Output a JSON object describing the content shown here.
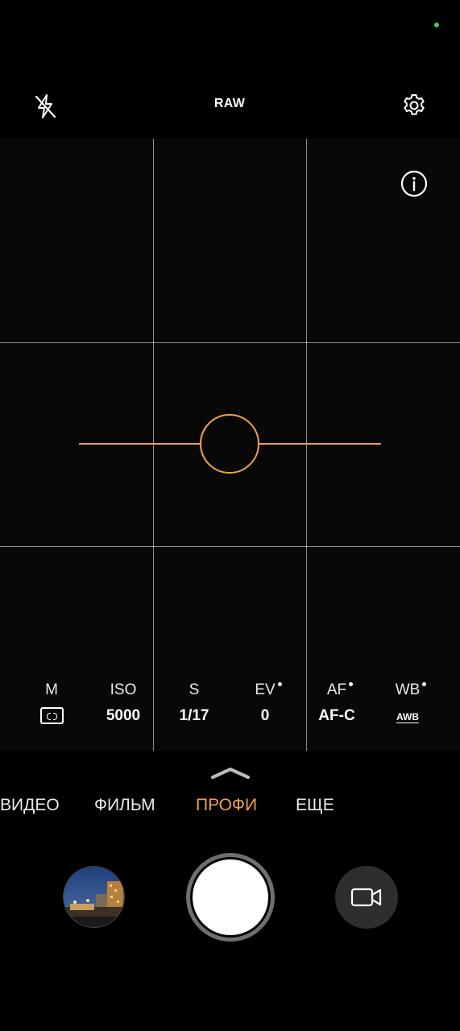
{
  "top_bar": {
    "raw_label": "RAW",
    "flash_icon": "flash-off-icon",
    "settings_icon": "gear-icon"
  },
  "viewfinder": {
    "info_icon": "info-icon",
    "level_color": "#f0a24a"
  },
  "params": [
    {
      "name": "M",
      "value": "",
      "icon": "metering-icon",
      "dot": false
    },
    {
      "name": "ISO",
      "value": "5000",
      "dot": false
    },
    {
      "name": "S",
      "value": "1/17",
      "dot": false
    },
    {
      "name": "EV",
      "value": "0",
      "dot": true
    },
    {
      "name": "AF",
      "value": "AF-C",
      "dot": true
    },
    {
      "name": "WB",
      "value": "AWB",
      "dot": true
    }
  ],
  "modes": {
    "items": [
      "ВИДЕО",
      "ФИЛЬМ",
      "ПРОФИ",
      "ЕЩЕ"
    ],
    "active": "ПРОФИ"
  },
  "controls": {
    "gallery_icon": "gallery-thumbnail",
    "shutter_icon": "shutter-button",
    "video_icon": "video-camera-icon"
  },
  "colors": {
    "accent": "#f0a24a",
    "status_dot": "#3ecf5a"
  }
}
